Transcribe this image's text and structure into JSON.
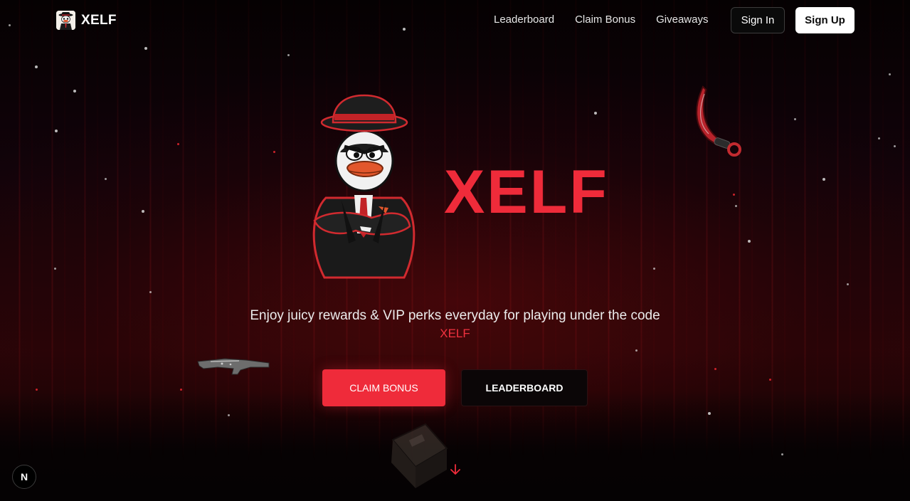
{
  "nav": {
    "brand": "XELF",
    "links": [
      {
        "label": "Leaderboard"
      },
      {
        "label": "Claim Bonus"
      },
      {
        "label": "Giveaways"
      }
    ],
    "sign_in": "Sign In",
    "sign_up": "Sign Up"
  },
  "hero": {
    "title": "XELF",
    "tagline": "Enjoy juicy rewards & VIP perks everyday for playing under the code",
    "code": "XELF",
    "claim_button": "CLAIM BONUS",
    "leaderboard_button": "LEADERBOARD"
  },
  "dev_badge": "N",
  "icons": {
    "brand_logo": "duck-mascot-logo",
    "mascot": "duck-mascot-illustration",
    "knife": "karambit-knife-icon",
    "rifle": "rifle-icon",
    "case": "weapon-case-icon",
    "scroll": "arrow-down-icon"
  },
  "colors": {
    "accent": "#ef2b3a",
    "background": "#050203",
    "text": "#f2f2f2"
  }
}
